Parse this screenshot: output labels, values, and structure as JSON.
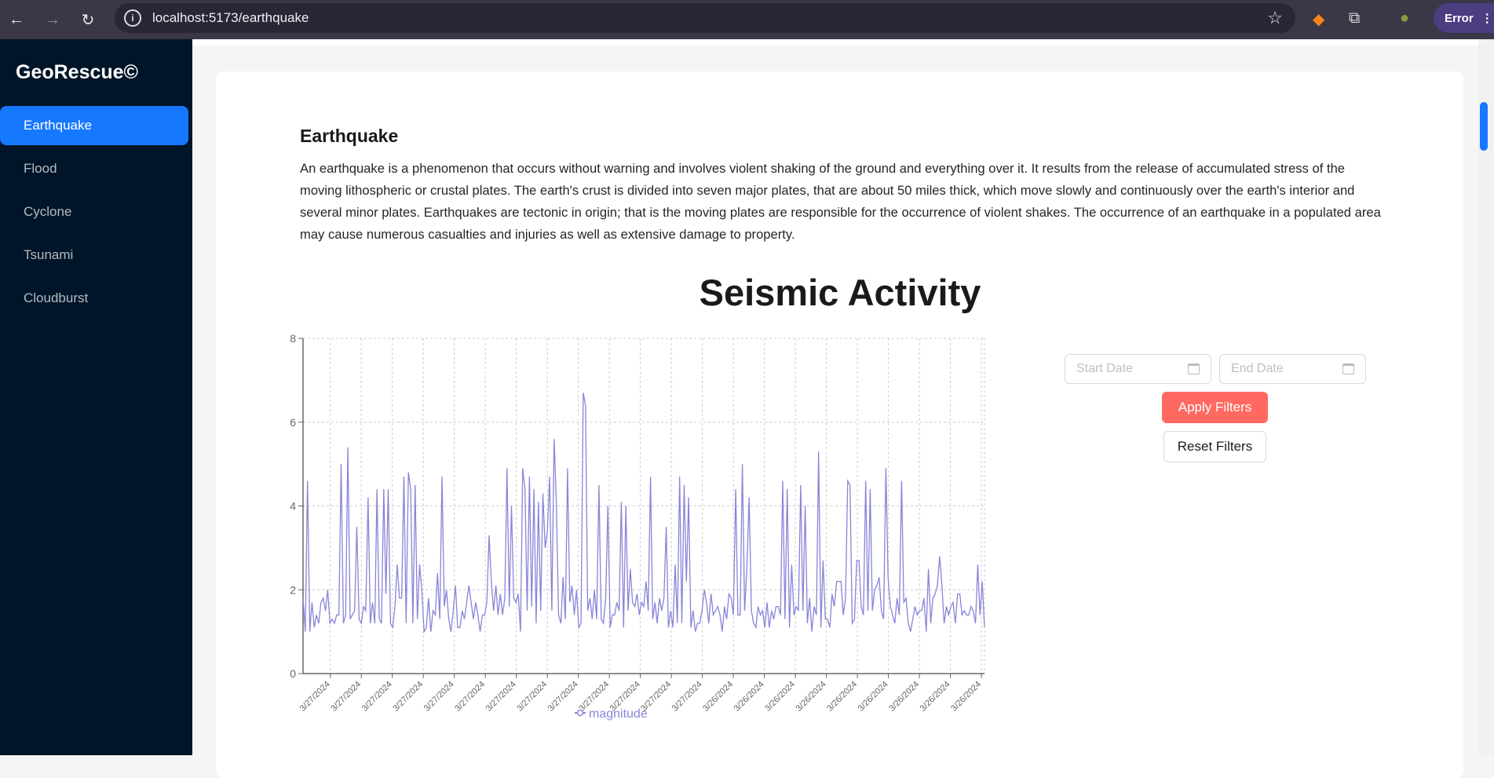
{
  "browser": {
    "url": "localhost:5173/earthquake",
    "error_label": "Error"
  },
  "sidebar": {
    "logo": "GeoRescue©",
    "items": [
      {
        "label": "Earthquake",
        "active": true
      },
      {
        "label": "Flood"
      },
      {
        "label": "Cyclone"
      },
      {
        "label": "Tsunami"
      },
      {
        "label": "Cloudburst"
      }
    ]
  },
  "content": {
    "heading": "Earthquake",
    "description": "An earthquake is a phenomenon that occurs without warning and involves violent shaking of the ground and everything over it. It results from the release of accumulated stress of the moving lithospheric or crustal plates. The earth's crust is divided into seven major plates, that are about 50 miles thick, which move slowly and continuously over the earth's interior and several minor plates. Earthquakes are tectonic in origin; that is the moving plates are responsible for the occurrence of violent shakes. The occurrence of an earthquake in a populated area may cause numerous casualties and injuries as well as extensive damage to property.",
    "chart_title": "Seismic Activity"
  },
  "filters": {
    "start_placeholder": "Start Date",
    "end_placeholder": "End Date",
    "apply_label": "Apply Filters",
    "reset_label": "Reset Filters",
    "apply_color": "#ff6961"
  },
  "chart_data": {
    "type": "line",
    "title": "Seismic Activity",
    "ylim": [
      0,
      8
    ],
    "yticks": [
      0,
      2,
      4,
      6,
      8
    ],
    "grid": true,
    "legend": {
      "position": "bottom",
      "entries": [
        "magnitude"
      ]
    },
    "line_color": "#8884d8",
    "xtick_labels": [
      "3/27/2024",
      "3/27/2024",
      "3/27/2024",
      "3/27/2024",
      "3/27/2024",
      "3/27/2024",
      "3/27/2024",
      "3/27/2024",
      "3/27/2024",
      "3/27/2024",
      "3/27/2024",
      "3/27/2024",
      "3/27/2024",
      "3/26/2024",
      "3/26/2024",
      "3/26/2024",
      "3/26/2024",
      "3/26/2024",
      "3/26/2024",
      "3/26/2024",
      "3/26/2024",
      "3/26/2024"
    ],
    "series": [
      {
        "name": "magnitude",
        "values": [
          1.8,
          1.0,
          4.6,
          1.0,
          1.7,
          1.1,
          1.4,
          1.2,
          1.7,
          1.8,
          1.5,
          2.0,
          1.2,
          1.3,
          1.2,
          1.4,
          1.4,
          5.0,
          1.2,
          1.4,
          5.4,
          1.3,
          1.4,
          1.5,
          3.5,
          1.3,
          1.2,
          1.6,
          1.5,
          4.2,
          1.2,
          1.7,
          1.2,
          4.4,
          1.3,
          1.2,
          4.4,
          1.9,
          4.4,
          1.2,
          1.1,
          1.6,
          2.6,
          1.8,
          1.8,
          4.7,
          1.2,
          4.8,
          4.4,
          1.2,
          4.5,
          1.3,
          2.6,
          2.0,
          1.0,
          1.1,
          1.8,
          1.0,
          1.5,
          1.4,
          2.4,
          1.3,
          4.7,
          1.6,
          2.0,
          1.3,
          1.0,
          1.5,
          2.1,
          1.1,
          1.1,
          1.5,
          1.3,
          1.7,
          2.1,
          1.7,
          1.3,
          1.7,
          1.4,
          1.0,
          1.4,
          1.4,
          1.7,
          3.3,
          2.2,
          1.5,
          2.1,
          1.4,
          1.9,
          1.4,
          1.8,
          4.9,
          1.6,
          4.0,
          1.8,
          1.7,
          1.9,
          1.0,
          4.9,
          4.4,
          1.5,
          4.7,
          1.6,
          4.4,
          1.2,
          4.1,
          1.5,
          4.3,
          3.0,
          3.4,
          4.7,
          1.5,
          5.6,
          4.1,
          1.4,
          1.2,
          2.3,
          1.3,
          4.9,
          1.7,
          2.1,
          1.4,
          2.0,
          1.1,
          1.2,
          6.7,
          6.4,
          1.5,
          1.8,
          1.3,
          2.0,
          1.3,
          4.5,
          1.3,
          1.2,
          1.8,
          4.0,
          1.1,
          1.4,
          1.4,
          1.7,
          1.5,
          4.1,
          1.1,
          4.0,
          1.5,
          2.5,
          1.7,
          1.6,
          1.9,
          1.4,
          1.7,
          1.6,
          2.2,
          1.5,
          4.7,
          1.3,
          1.7,
          1.2,
          1.8,
          1.5,
          1.8,
          3.5,
          1.1,
          1.5,
          1.1,
          2.6,
          1.2,
          4.7,
          1.2,
          4.5,
          2.2,
          4.2,
          1.1,
          1.5,
          1.0,
          1.2,
          1.2,
          1.5,
          2.0,
          1.7,
          1.2,
          1.9,
          1.4,
          1.5,
          1.6,
          1.4,
          1.0,
          1.6,
          1.3,
          1.9,
          1.8,
          1.4,
          4.4,
          1.4,
          1.4,
          5.0,
          1.5,
          2.5,
          4.2,
          1.5,
          1.2,
          1.1,
          1.6,
          1.4,
          1.5,
          1.1,
          1.7,
          1.1,
          1.5,
          1.3,
          1.6,
          1.6,
          1.4,
          4.6,
          1.3,
          4.4,
          1.1,
          2.6,
          1.4,
          1.6,
          1.5,
          4.5,
          1.5,
          4.0,
          1.2,
          1.8,
          1.0,
          1.6,
          1.4,
          5.3,
          1.1,
          2.7,
          1.3,
          1.3,
          1.1,
          1.9,
          1.6,
          2.2,
          2.2,
          2.2,
          1.4,
          1.8,
          4.6,
          4.5,
          1.2,
          1.3,
          2.7,
          2.7,
          1.6,
          1.4,
          4.6,
          1.5,
          4.4,
          1.5,
          2.0,
          2.1,
          2.3,
          1.5,
          1.3,
          4.9,
          2.3,
          1.6,
          1.4,
          1.2,
          1.8,
          1.4,
          4.6,
          1.7,
          1.8,
          1.2,
          1.0,
          1.3,
          1.6,
          1.4,
          1.5,
          1.5,
          1.8,
          1.0,
          2.5,
          1.2,
          1.8,
          1.9,
          2.1,
          2.8,
          2.1,
          1.2,
          1.6,
          1.4,
          1.6,
          1.7,
          1.2,
          1.9,
          1.9,
          1.4,
          1.5,
          1.4,
          1.4,
          1.6,
          1.5,
          1.2,
          2.6,
          1.4,
          2.2,
          1.1
        ]
      }
    ]
  }
}
